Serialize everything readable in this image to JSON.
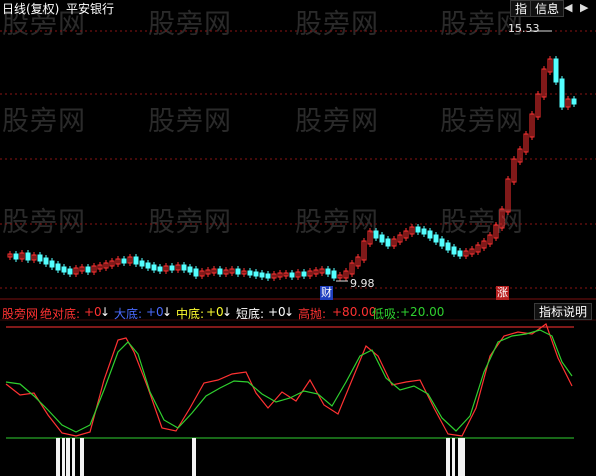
{
  "header": {
    "period_label": "日线(复权)",
    "stock_name": "平安银行",
    "btn_index": "指",
    "btn_info": "信息",
    "nav_left": "◀",
    "nav_right": "▶"
  },
  "price_chart": {
    "high_label": "15.53",
    "low_label": "9.98",
    "badge_cai": "财",
    "badge_zhang": "涨"
  },
  "watermark": "股旁网",
  "indicator": {
    "name": "股旁网",
    "items": [
      {
        "label": "绝对底:",
        "value": "+0",
        "arrow": "↓"
      },
      {
        "label": "大底:",
        "value": "+0",
        "arrow": "↓"
      },
      {
        "label": "中底:",
        "value": "+0",
        "arrow": "↓"
      },
      {
        "label": "短底:",
        "value": "+0",
        "arrow": "↓"
      }
    ],
    "high_throw_label": "高抛:",
    "high_throw_value": "+80.00",
    "low_buy_label": "低吸:",
    "low_buy_value": "+20.00",
    "help_button": "指标说明"
  },
  "colors": {
    "up": "#ff3232",
    "down": "#54ffff",
    "grid": "#8a1414",
    "line_red": "#ff3232",
    "line_green": "#2fd02f",
    "low_line": "#2fd02f",
    "high_line": "#ff3232",
    "bars": "#f2f2f2"
  }
}
